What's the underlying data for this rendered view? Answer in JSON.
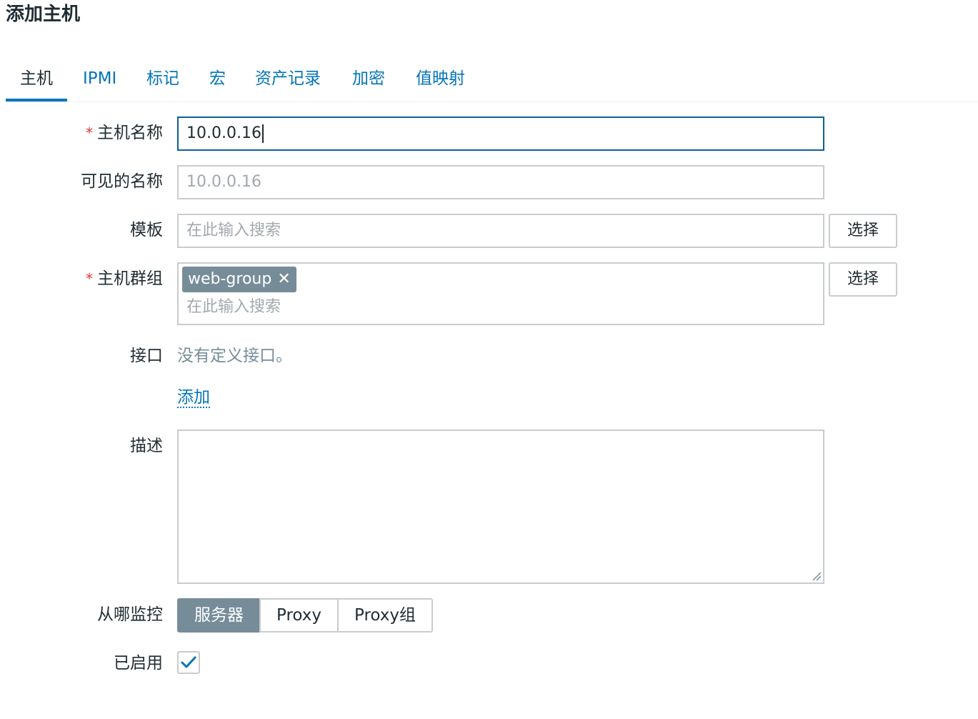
{
  "page": {
    "title": "添加主机"
  },
  "tabs": [
    {
      "label": "主机",
      "active": true
    },
    {
      "label": "IPMI",
      "active": false
    },
    {
      "label": "标记",
      "active": false
    },
    {
      "label": "宏",
      "active": false
    },
    {
      "label": "资产记录",
      "active": false
    },
    {
      "label": "加密",
      "active": false
    },
    {
      "label": "值映射",
      "active": false
    }
  ],
  "form": {
    "host_name": {
      "label": "主机名称",
      "required_mark": "*",
      "value": "10.0.0.16"
    },
    "visible_name": {
      "label": "可见的名称",
      "placeholder": "10.0.0.16"
    },
    "templates": {
      "label": "模板",
      "placeholder": "在此输入搜索",
      "select_label": "选择"
    },
    "host_groups": {
      "label": "主机群组",
      "required_mark": "*",
      "chips": [
        "web-group"
      ],
      "chip_close_icon": "close-icon",
      "placeholder": "在此输入搜索",
      "select_label": "选择"
    },
    "interfaces": {
      "label": "接口",
      "empty_text": "没有定义接口。",
      "add_label": "添加"
    },
    "description": {
      "label": "描述",
      "value": ""
    },
    "monitored_by": {
      "label": "从哪监控",
      "options": [
        "服务器",
        "Proxy",
        "Proxy组"
      ],
      "selected": "服务器"
    },
    "enabled": {
      "label": "已启用",
      "checked": true
    }
  },
  "colors": {
    "accent": "#0275b8",
    "required": "#e33734",
    "chip_bg": "#768d99",
    "border": "#c8ccce",
    "focus_border": "#0f6096",
    "text": "#1f2c33",
    "placeholder": "#a1a9ad"
  }
}
